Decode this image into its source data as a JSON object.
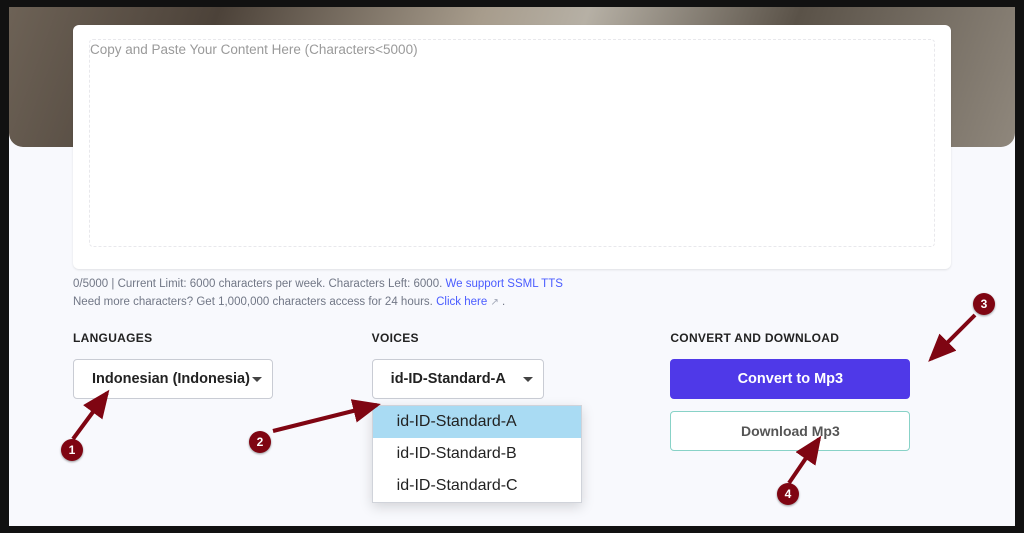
{
  "textarea": {
    "placeholder": "Copy and Paste Your Content Here (Characters<5000)"
  },
  "meta": {
    "counter": "0/5000",
    "limit_text": "Current Limit: 6000 characters per week. Characters Left: 6000.",
    "ssml_link": "We support SSML TTS",
    "more_text": "Need more characters? Get 1,000,000 characters access for 24 hours.",
    "click_here": "Click here"
  },
  "languages": {
    "heading": "LANGUAGES",
    "selected": "Indonesian (Indonesia)"
  },
  "voices": {
    "heading": "VOICES",
    "selected": "id-ID-Standard-A",
    "options": [
      "id-ID-Standard-A",
      "id-ID-Standard-B",
      "id-ID-Standard-C"
    ]
  },
  "convert": {
    "heading": "CONVERT AND DOWNLOAD",
    "convert_label": "Convert to Mp3",
    "download_label": "Download Mp3"
  },
  "annotations": {
    "b1": "1",
    "b2": "2",
    "b3": "3",
    "b4": "4"
  }
}
